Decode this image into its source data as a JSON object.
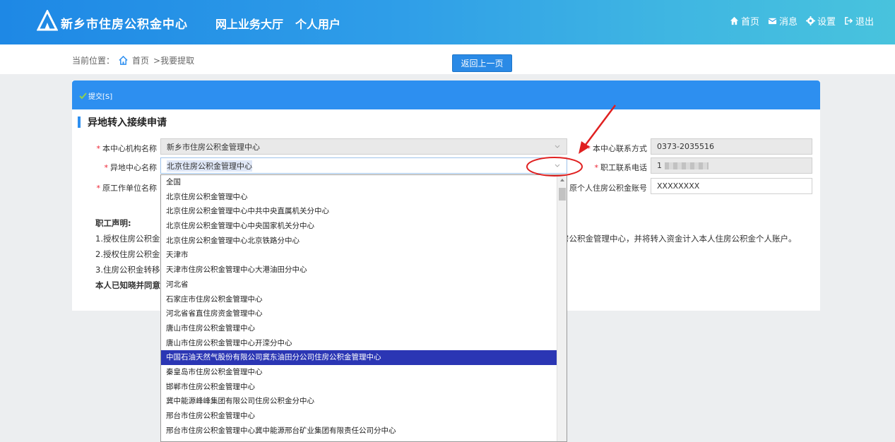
{
  "header": {
    "logo_text": "新乡市住房公积金中心",
    "hall": "网上业务大厅",
    "personal": "个人用户",
    "nav": [
      {
        "label": "首页",
        "icon": "home-icon"
      },
      {
        "label": "消息",
        "icon": "message-icon"
      },
      {
        "label": "设置",
        "icon": "gear-icon"
      },
      {
        "label": "退出",
        "icon": "logout-icon"
      }
    ]
  },
  "breadcrumb": {
    "prefix": "当前位置：",
    "home": "首页",
    "current": ">我要提取"
  },
  "back_button": "返回上一页",
  "toolbar": {
    "submit": "提交[S]"
  },
  "form": {
    "title": "异地转入接续申请",
    "center_name_label": "本中心机构名称",
    "center_name_value": "新乡市住房公积金管理中心",
    "contact_label": "本中心联系方式",
    "contact_value": "0373-2035516",
    "remote_center_label": "异地中心名称",
    "remote_center_value": "北京住房公积金管理中心",
    "phone_label": "职工联系电话",
    "phone_value": "1",
    "employer_label": "原工作单位名称",
    "account_label": "原个人住房公积金账号",
    "account_value": "XXXXXXXX"
  },
  "declaration": {
    "title": "职工声明:",
    "line1_start": "1.授权住房公积金",
    "line1_end": "房公积金管理中心，并将转入资金计入本人住房公积金个人账户。",
    "line2": "2.授权住房公积金",
    "line3": "3.住房公积金转移",
    "line4": "本人已知晓并同意"
  },
  "dropdown": {
    "selected_index": 12,
    "options": [
      "全国",
      "北京住房公积金管理中心",
      "北京住房公积金管理中心中共中央直属机关分中心",
      "北京住房公积金管理中心中央国家机关分中心",
      "北京住房公积金管理中心北京铁路分中心",
      "天津市",
      "天津市住房公积金管理中心大港油田分中心",
      "河北省",
      "石家庄市住房公积金管理中心",
      "河北省省直住房资金管理中心",
      "唐山市住房公积金管理中心",
      "唐山市住房公积金管理中心开滦分中心",
      "中国石油天然气股份有限公司冀东油田分公司住房公积金管理中心",
      "秦皇岛市住房公积金管理中心",
      "邯郸市住房公积金管理中心",
      "冀中能源峰峰集团有限公司住房公积金分中心",
      "邢台市住房公积金管理中心",
      "邢台市住房公积金管理中心冀中能源邢台矿业集团有限责任公司分中心"
    ]
  },
  "colors": {
    "accent": "#2d8ff0",
    "selected": "#2b36b4",
    "annotation": "#e02020"
  }
}
